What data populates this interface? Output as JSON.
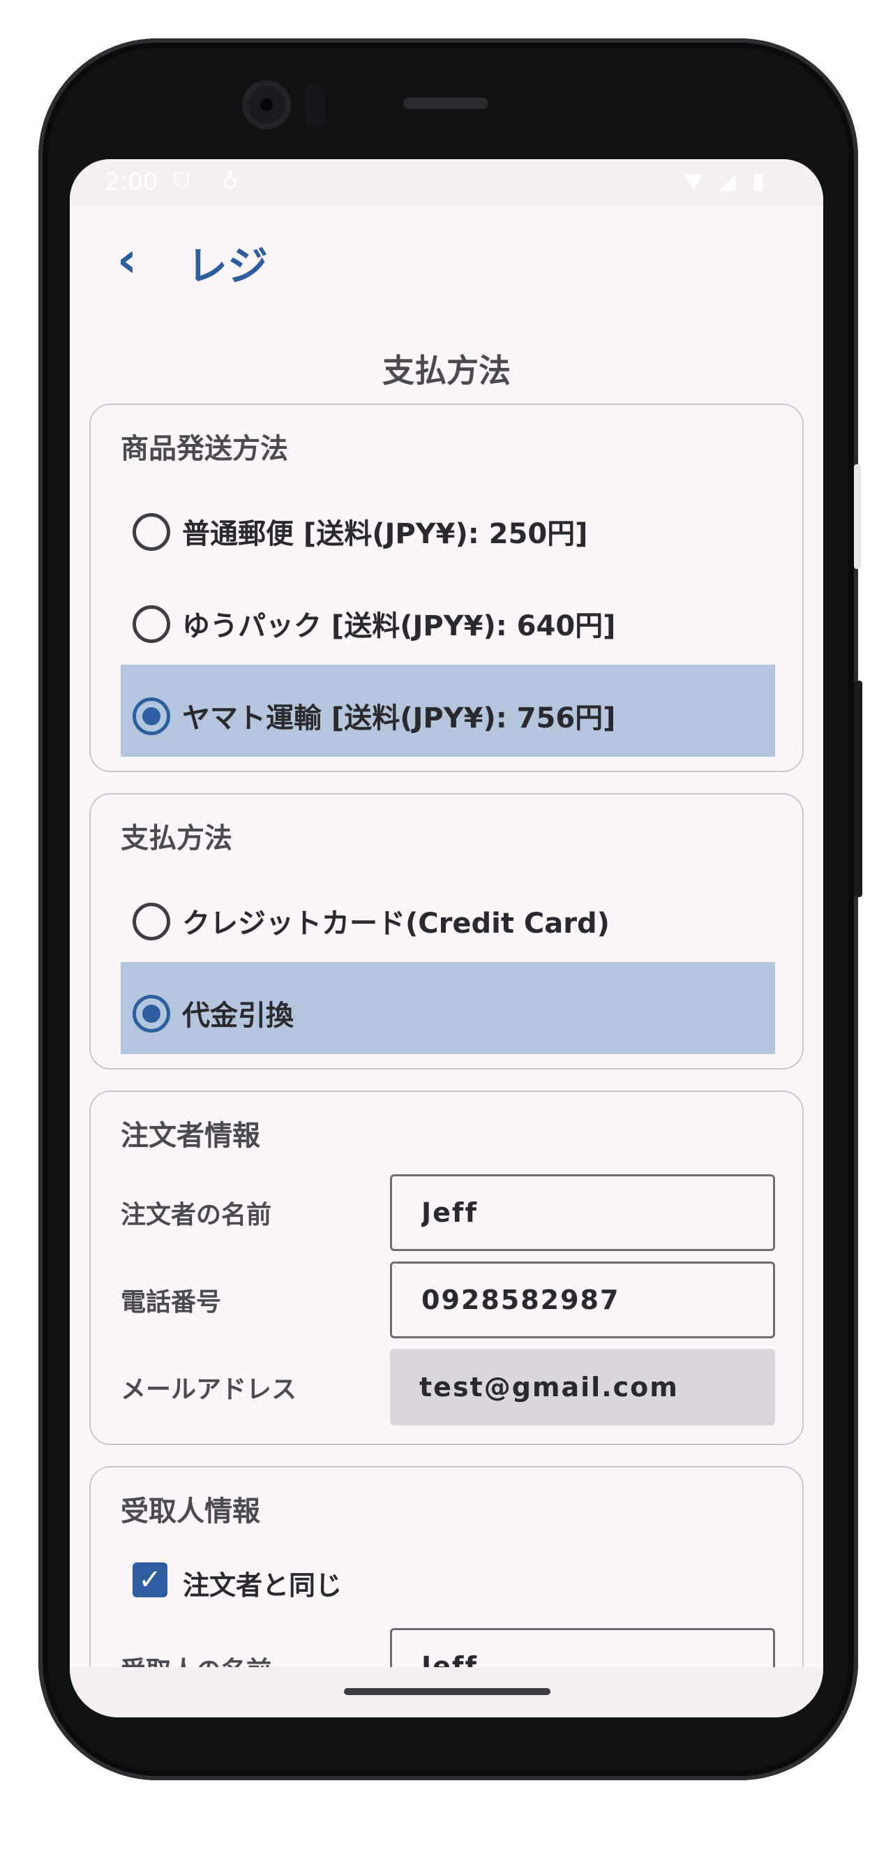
{
  "status_bar": {
    "time": "2:00"
  },
  "top_bar": {
    "back_icon": "chevron-left-icon",
    "title": "レジ"
  },
  "page_title": "支払方法",
  "shipping": {
    "title": "商品発送方法",
    "options": [
      {
        "label": "普通郵便 [送料(JPY¥): 250円]",
        "selected": false
      },
      {
        "label": "ゆうパック [送料(JPY¥): 640円]",
        "selected": false
      },
      {
        "label": "ヤマト運輸 [送料(JPY¥): 756円]",
        "selected": true
      }
    ]
  },
  "payment": {
    "title": "支払方法",
    "options": [
      {
        "label": "クレジットカード(Credit Card)",
        "selected": false
      },
      {
        "label": "代金引換",
        "selected": true
      }
    ]
  },
  "orderer": {
    "title": "注文者情報",
    "name_label": "注文者の名前",
    "name_value": "Jeff",
    "phone_label": "電話番号",
    "phone_value": "0928582987",
    "email_label": "メールアドレス",
    "email_value": "test@gmail.com"
  },
  "recipient": {
    "title": "受取人情報",
    "same_as_orderer_label": "注文者と同じ",
    "same_as_orderer_checked": true,
    "name_label": "受取人の名前",
    "name_value": "Jeff"
  },
  "colors": {
    "accent": "#2c5ea0",
    "selected_row": "#b4c6de",
    "background": "#fcf6fb"
  }
}
